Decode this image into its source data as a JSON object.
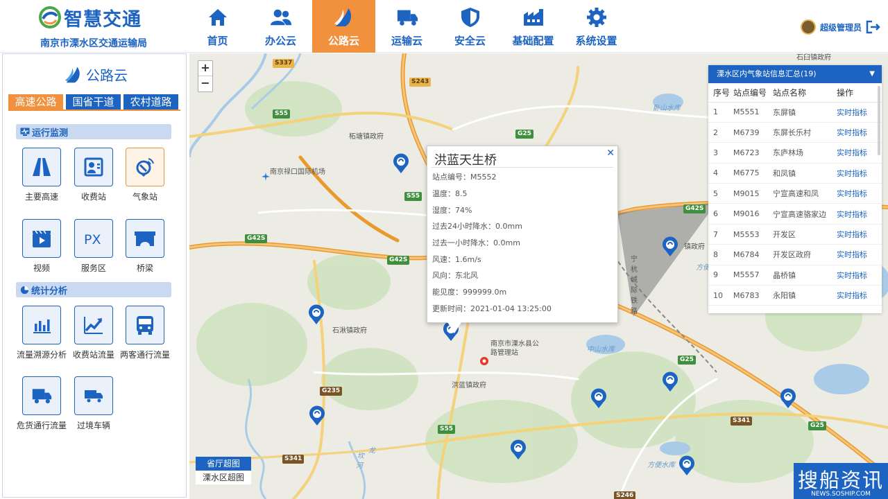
{
  "brand": {
    "title": "智慧交通",
    "subtitle": "南京市溧水区交通运输局"
  },
  "nav": [
    {
      "label": "首页",
      "icon": "home-icon"
    },
    {
      "label": "办公云",
      "icon": "users-icon"
    },
    {
      "label": "公路云",
      "icon": "road-logo-icon",
      "active": true
    },
    {
      "label": "运输云",
      "icon": "truck-icon"
    },
    {
      "label": "安全云",
      "icon": "shield-icon"
    },
    {
      "label": "基础配置",
      "icon": "factory-icon"
    },
    {
      "label": "系统设置",
      "icon": "gear-icon"
    }
  ],
  "user": {
    "name": "超级管理员"
  },
  "panel": {
    "title": "公路云",
    "tabs": [
      "高速公路",
      "国省干道",
      "农村道路"
    ],
    "section1": "运行监测",
    "monitor": [
      "主要高速",
      "收费站",
      "气象站",
      "视频",
      "服务区",
      "桥梁"
    ],
    "section2": "统计分析",
    "stats": [
      "流量溯源分析",
      "收费站流量",
      "两客通行流量",
      "危货通行流量",
      "过境车辆"
    ]
  },
  "map": {
    "zoom_in": "+",
    "zoom_out": "−",
    "labels": {
      "airport": "南京禄口国际机场",
      "zhetang": "柘塘镇政府",
      "shiqiu": "石湫镇政府",
      "honglan": "洪蓝镇政府",
      "bureau": "南京市溧水县公路管理站",
      "zhongshan": "中山水库",
      "fangbian": "方便水库",
      "xieshan": "卧山水库",
      "ninghang": "宁杭城际铁路",
      "town": "镇政府",
      "lake": "方便",
      "kan": "坎",
      "long": "龙",
      "he": "河",
      "shilin": "石臼镇政府"
    },
    "shields": [
      "S337",
      "S243",
      "S55",
      "G25",
      "G42S",
      "S55",
      "G42S",
      "G42S",
      "G25",
      "G235",
      "S55",
      "S341",
      "S341",
      "G25",
      "S246"
    ],
    "tabs": [
      "省厅超图",
      "溧水区超图"
    ]
  },
  "popup": {
    "title": "洪蓝天生桥",
    "rows": [
      "站点编号：M5552",
      "温度：8.5",
      "湿度：74%",
      "过去24小时降水：0.0mm",
      "过去一小时降水：0.0mm",
      "风速：1.6m/s",
      "风向：东北风",
      "能见度：999999.0m",
      "更新时间：2021-01-04 13:25:00"
    ]
  },
  "stations": {
    "title": "溧水区内气象站信息汇总(19)",
    "headers": [
      "序号",
      "站点编号",
      "站点名称",
      "操作"
    ],
    "rows": [
      [
        "1",
        "M5551",
        "东屏镇",
        "实时指标"
      ],
      [
        "2",
        "M6739",
        "东屏长乐村",
        "实时指标"
      ],
      [
        "3",
        "M6723",
        "东庐林场",
        "实时指标"
      ],
      [
        "4",
        "M6775",
        "和凤镇",
        "实时指标"
      ],
      [
        "5",
        "M9015",
        "宁宣高速和凤",
        "实时指标"
      ],
      [
        "6",
        "M9016",
        "宁宣高速骆家边",
        "实时指标"
      ],
      [
        "7",
        "M5553",
        "开发区",
        "实时指标"
      ],
      [
        "8",
        "M6784",
        "开发区政府",
        "实时指标"
      ],
      [
        "9",
        "M5557",
        "晶桥镇",
        "实时指标"
      ],
      [
        "10",
        "M6783",
        "永阳镇",
        "实时指标"
      ]
    ]
  },
  "watermark": {
    "main": "搜船资讯",
    "sub": "NEWS.SOSHIP.COM"
  },
  "colors": {
    "primary": "#1d64c2",
    "accent": "#f2913d"
  }
}
